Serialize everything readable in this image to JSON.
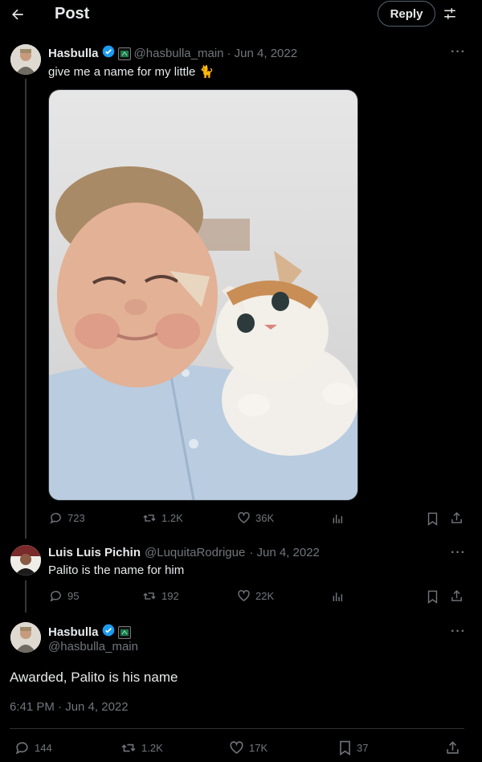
{
  "header": {
    "title": "Post",
    "reply_label": "Reply"
  },
  "main_post": {
    "display_name": "Hasbulla",
    "handle": "@hasbulla_main",
    "date": "· Jun 4, 2022",
    "text": "give me a name for my little 🐈",
    "stats": {
      "replies": "723",
      "reposts": "1.2K",
      "likes": "36K"
    }
  },
  "reply_post": {
    "display_name": "Luis Luis Pichin",
    "handle": "@LuquitaRodrigue",
    "date": "· Jun 4, 2022",
    "text": "Palito is the name for him",
    "stats": {
      "replies": "95",
      "reposts": "192",
      "likes": "22K"
    }
  },
  "focus_post": {
    "display_name": "Hasbulla",
    "handle": "@hasbulla_main",
    "text": "Awarded, Palito is his name",
    "timestamp": "6:41 PM · Jun 4, 2022",
    "stats": {
      "replies": "144",
      "reposts": "1.2K",
      "likes": "17K",
      "bookmarks": "37"
    }
  },
  "colors": {
    "verified": "#1d9bf0",
    "background": "#000000",
    "muted": "#71767b"
  }
}
